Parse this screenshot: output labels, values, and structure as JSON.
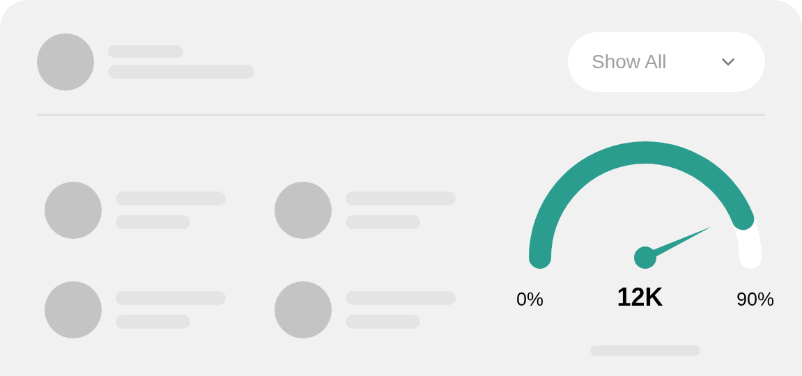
{
  "dropdown": {
    "value": "Show All"
  },
  "gauge": {
    "min_label": "0%",
    "value": "12K",
    "max_label": "90%"
  }
}
